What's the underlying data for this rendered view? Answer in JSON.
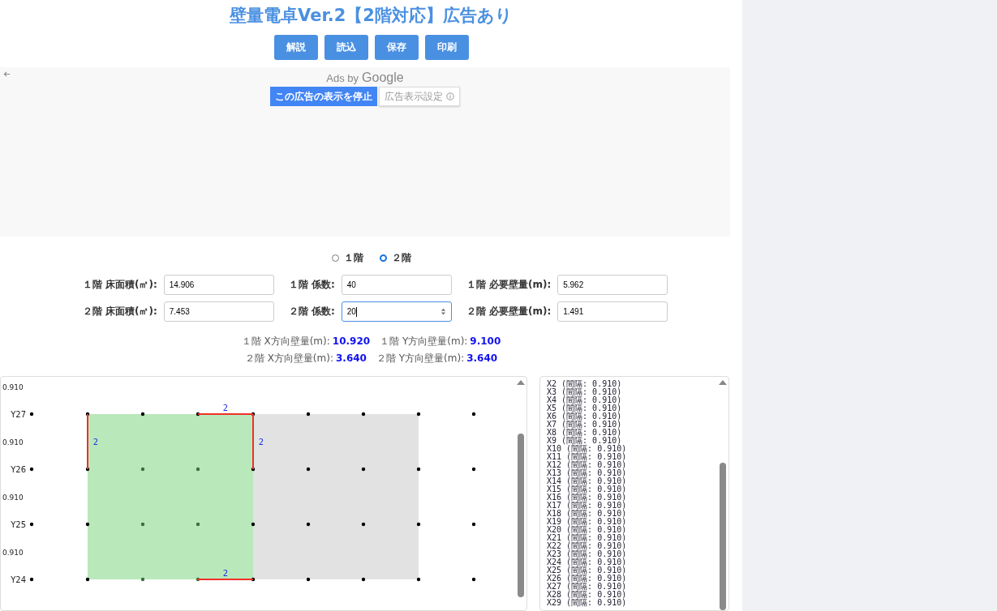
{
  "title": "壁量電卓Ver.2【2階対応】広告あり",
  "buttons": [
    "解説",
    "読込",
    "保存",
    "印刷"
  ],
  "ad": {
    "ads_by": "Ads by",
    "brand": "Google",
    "stop_button": "この広告の表示を停止",
    "settings_button": "広告表示設定"
  },
  "floors": [
    {
      "label": "１階",
      "selected": false
    },
    {
      "label": "２階",
      "selected": true
    }
  ],
  "form_rows": [
    [
      {
        "label": "１階 床面積(㎡):",
        "value": "14.906",
        "focused": false
      },
      {
        "label": "１階 係数:",
        "value": "40",
        "focused": false
      },
      {
        "label": "１階 必要壁量(m):",
        "value": "5.962",
        "focused": false
      }
    ],
    [
      {
        "label": "２階 床面積(㎡):",
        "value": "7.453",
        "focused": false
      },
      {
        "label": "２階 係数:",
        "value": "20",
        "focused": true
      },
      {
        "label": "２階 必要壁量(m):",
        "value": "1.491",
        "focused": false
      }
    ]
  ],
  "results": [
    [
      {
        "label": "１階 X方向壁量(m):",
        "value": "10.920"
      },
      {
        "label": "１階 Y方向壁量(m):",
        "value": "9.100"
      }
    ],
    [
      {
        "label": "２階 X方向壁量(m):",
        "value": "3.640"
      },
      {
        "label": "２階 Y方向壁量(m):",
        "value": "3.640"
      }
    ]
  ],
  "plan": {
    "spacing_labels": [
      "0.910",
      "0.910",
      "0.910",
      "0.910"
    ],
    "rows": [
      "Y27",
      "Y26",
      "Y25",
      "Y24"
    ],
    "areas": [
      {
        "kind": "current_floor"
      },
      {
        "kind": "other_floor"
      }
    ],
    "walls": [
      {
        "kind": "left",
        "label": "2"
      },
      {
        "kind": "top",
        "label": "2"
      },
      {
        "kind": "right",
        "label": "2"
      },
      {
        "kind": "bottom",
        "label": "2"
      }
    ]
  },
  "grid_list": [
    "X2 (間隔: 0.910)",
    "X3 (間隔: 0.910)",
    "X4 (間隔: 0.910)",
    "X5 (間隔: 0.910)",
    "X6 (間隔: 0.910)",
    "X7 (間隔: 0.910)",
    "X8 (間隔: 0.910)",
    "X9 (間隔: 0.910)",
    "X10 (間隔: 0.910)",
    "X11 (間隔: 0.910)",
    "X12 (間隔: 0.910)",
    "X13 (間隔: 0.910)",
    "X14 (間隔: 0.910)",
    "X15 (間隔: 0.910)",
    "X16 (間隔: 0.910)",
    "X17 (間隔: 0.910)",
    "X18 (間隔: 0.910)",
    "X19 (間隔: 0.910)",
    "X20 (間隔: 0.910)",
    "X21 (間隔: 0.910)",
    "X22 (間隔: 0.910)",
    "X23 (間隔: 0.910)",
    "X24 (間隔: 0.910)",
    "X25 (間隔: 0.910)",
    "X26 (間隔: 0.910)",
    "X27 (間隔: 0.910)",
    "X28 (間隔: 0.910)",
    "X29 (間隔: 0.910)"
  ]
}
